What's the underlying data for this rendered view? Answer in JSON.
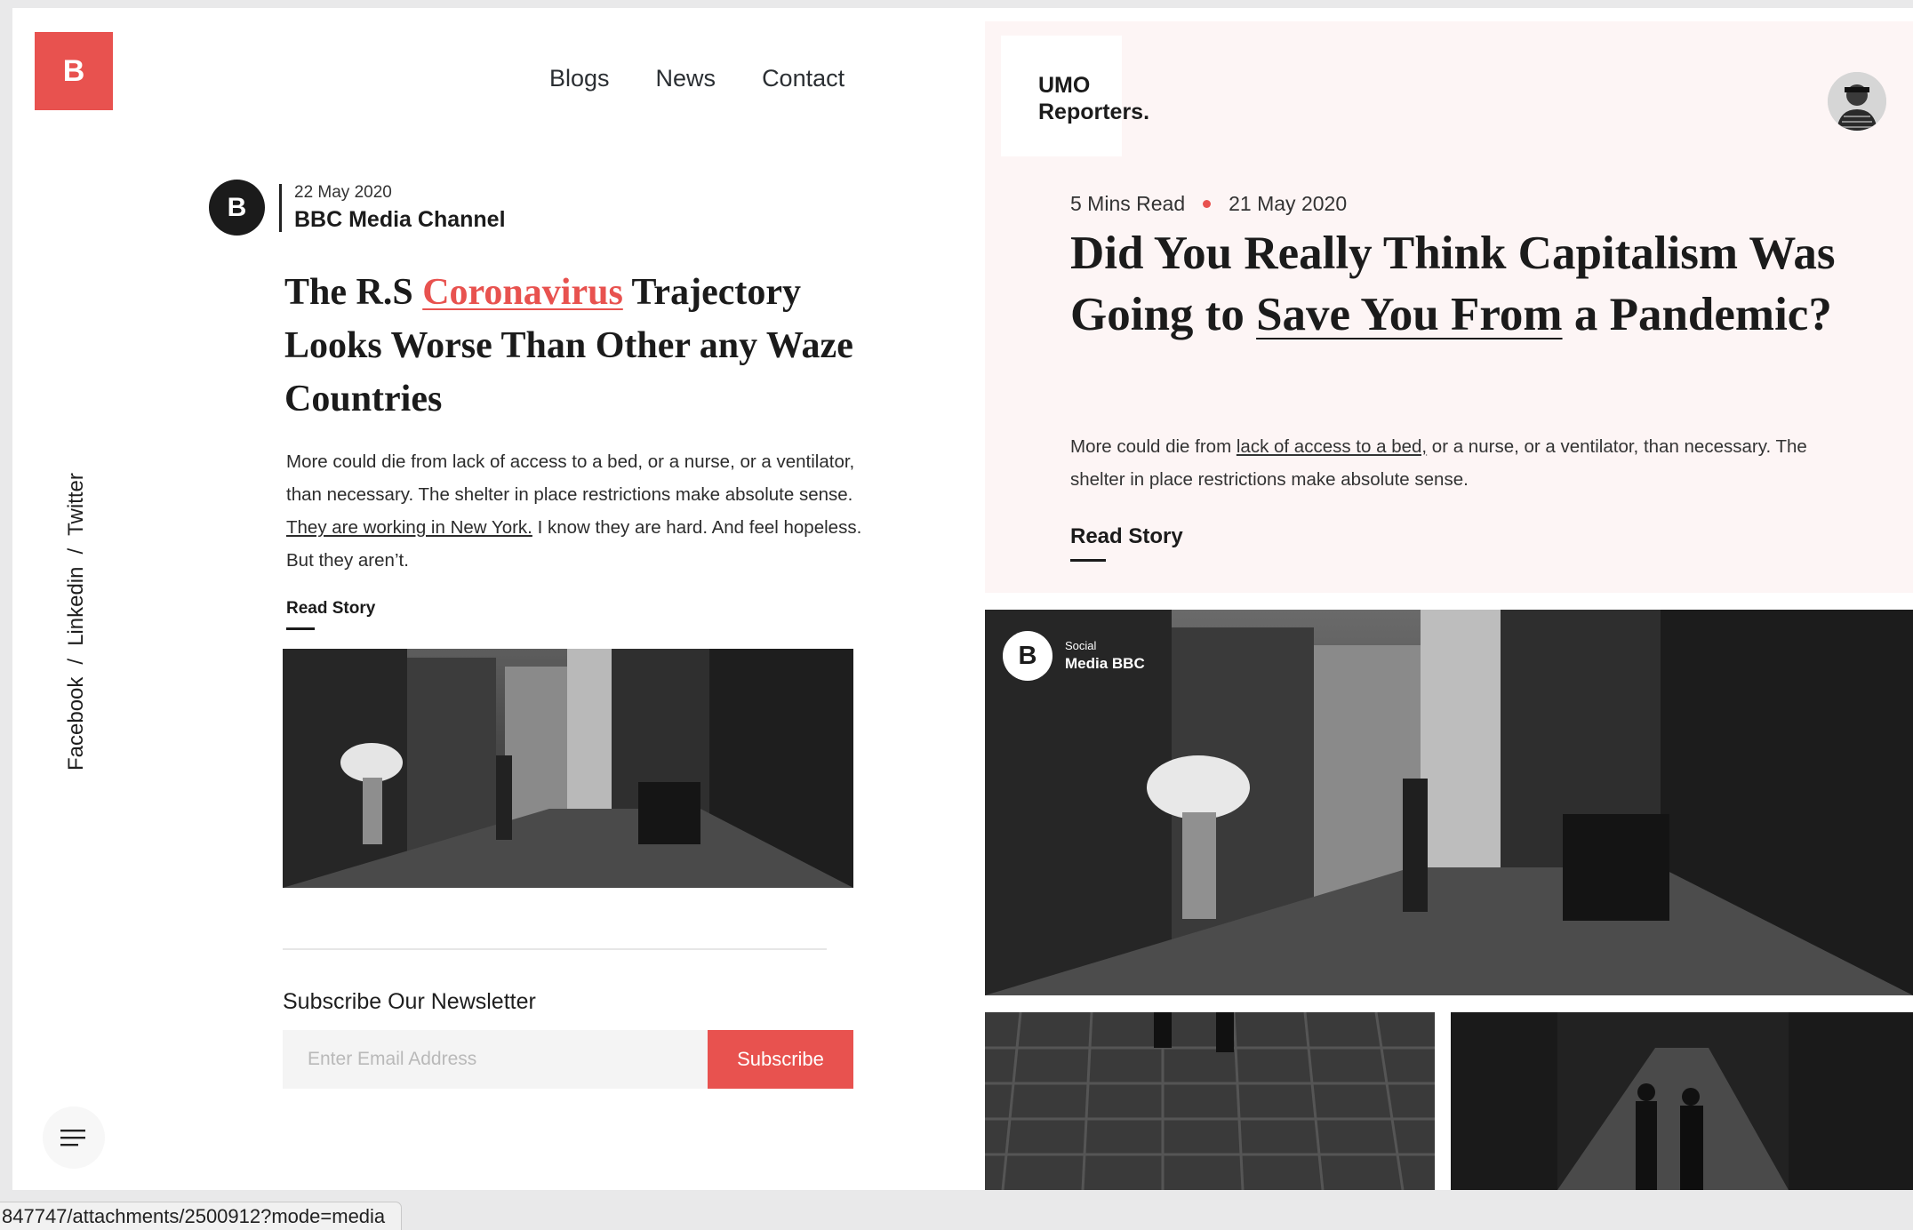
{
  "logo": {
    "letter": "B",
    "color": "#e8524f"
  },
  "nav": {
    "items": [
      "Blogs",
      "News",
      "Contact"
    ]
  },
  "social": {
    "facebook": "Facebook",
    "linkedin": "Linkedin",
    "twitter": "Twitter",
    "separator": "/"
  },
  "left_post": {
    "author_letter": "B",
    "date": "22 May 2020",
    "channel": "BBC Media Channel",
    "title_prefix": "The R.S ",
    "title_highlight": "Coronavirus",
    "title_suffix": " Trajectory Looks Worse Than Other any Waze Countries",
    "body_part1": "More could die from lack of access to a bed, or a nurse, or a ventilator, than necessary. The shelter in place restrictions make absolute sense. ",
    "body_link": "They are working in New York.",
    "body_part2": " I know they are hard. And feel hopeless. But they aren’t.",
    "read_label": "Read Story"
  },
  "newsletter": {
    "title": "Subscribe Our Newsletter",
    "placeholder": "Enter Email Address",
    "button": "Subscribe"
  },
  "brand": {
    "name": "UMO\nReporters."
  },
  "featured": {
    "read_time": "5 Mins Read",
    "date": "21 May 2020",
    "title_part1": "Did You Really Think Capitalism Was Going to ",
    "title_link": "Save You From",
    "title_part2": " a Pandemic?",
    "body_part1": "More could die from ",
    "body_link": "lack of access to a bed,",
    "body_part2": " or a nurse, or a ventilator, than necessary. The shelter in place restrictions make absolute sense.",
    "read_label": "Read Story"
  },
  "image_badge": {
    "letter": "B",
    "line1": "Social",
    "line2": "Media BBC"
  },
  "status_bar": {
    "url": "847747/attachments/2500912?mode=media"
  },
  "colors": {
    "accent": "#e8524f",
    "feature_bg": "#fdf5f5",
    "text": "#1b1b1b"
  }
}
